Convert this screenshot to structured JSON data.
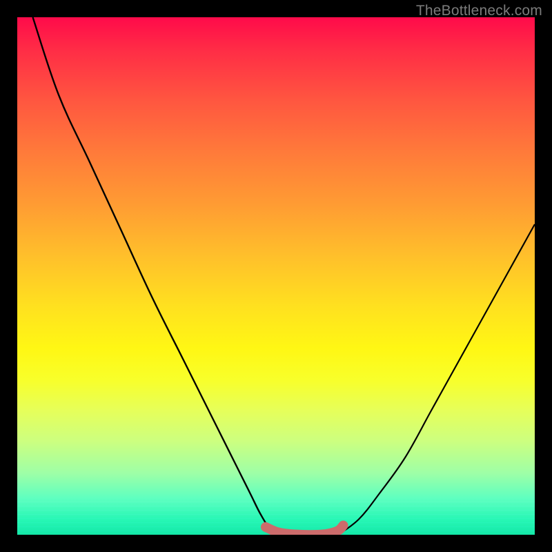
{
  "watermark": "TheBottleneck.com",
  "chart_data": {
    "type": "line",
    "title": "",
    "xlabel": "",
    "ylabel": "",
    "xlim": [
      0,
      100
    ],
    "ylim": [
      0,
      100
    ],
    "grid": false,
    "legend": false,
    "series": [
      {
        "name": "left-curve",
        "x": [
          3,
          8,
          14,
          20,
          26,
          32,
          38,
          42,
          45,
          47,
          49,
          51
        ],
        "y": [
          100,
          85,
          72,
          59,
          46,
          34,
          22,
          14,
          8,
          4,
          1,
          0
        ]
      },
      {
        "name": "right-curve",
        "x": [
          62,
          66,
          70,
          75,
          80,
          85,
          90,
          95,
          100
        ],
        "y": [
          0,
          3,
          8,
          15,
          24,
          33,
          42,
          51,
          60
        ]
      },
      {
        "name": "bottom-marker",
        "x": [
          48,
          50,
          52,
          55,
          58,
          60,
          62,
          63
        ],
        "y": [
          1.5,
          0.6,
          0.2,
          0,
          0,
          0.2,
          0.8,
          1.8
        ]
      }
    ],
    "colors": {
      "curve": "#000000",
      "marker": "#cc6b6b"
    }
  }
}
